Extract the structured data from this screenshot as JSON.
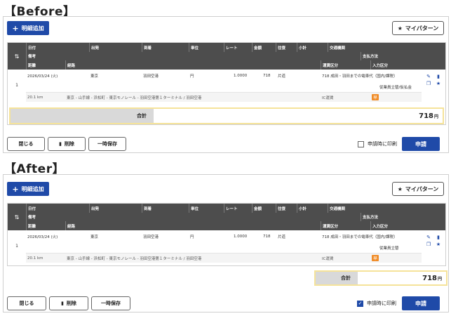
{
  "before": {
    "section_title": "【Before】",
    "total_label": "合計",
    "total_amount": "718",
    "total_unit": "円",
    "row_payment_method": "従業員立替/仮払金",
    "print_on_apply_checked": false
  },
  "after": {
    "section_title": "【After】",
    "total_label": "合計",
    "total_amount": "718",
    "total_unit": "円",
    "row_payment_method": "従業員立替",
    "print_on_apply_checked": true
  },
  "toolbar": {
    "add_line_label": "明細追加",
    "my_pattern_label": "マイパターン"
  },
  "table": {
    "headers_row1": [
      "日付",
      "出発",
      "到着",
      "単位",
      "レート",
      "金額",
      "往復",
      "小計",
      "交通機関"
    ],
    "headers_row2_left": "備考",
    "headers_row2_right": "支払方法",
    "headers_row3": [
      "距離",
      "経路",
      "運賃区分",
      "入力区分"
    ]
  },
  "row": {
    "number": "1",
    "date": "2026/03/24 (火)",
    "from": "東京",
    "to": "羽田空港",
    "unit": "円",
    "rate": "1.0000",
    "amount": "718",
    "roundtrip": "片道",
    "subtotal_purpose": "718 成田・羽田までの電車代（国内/課税）",
    "distance": "20.1 km",
    "route": "東京 - 山手線 - 浜松町 - 東京モノレール - 羽田空港第１ターミナル / 羽田空港",
    "fare_type": "IC運賃",
    "input_tag": "早"
  },
  "footer": {
    "close_label": "閉じる",
    "delete_label": "削除",
    "temp_save_label": "一時保存",
    "print_label": "申請時に印刷",
    "apply_label": "申請"
  },
  "colors": {
    "primary": "#1f4aa8",
    "header_bg": "#4d4d4d",
    "highlight_border": "#f5e39a",
    "tag_orange": "#f08c28"
  }
}
